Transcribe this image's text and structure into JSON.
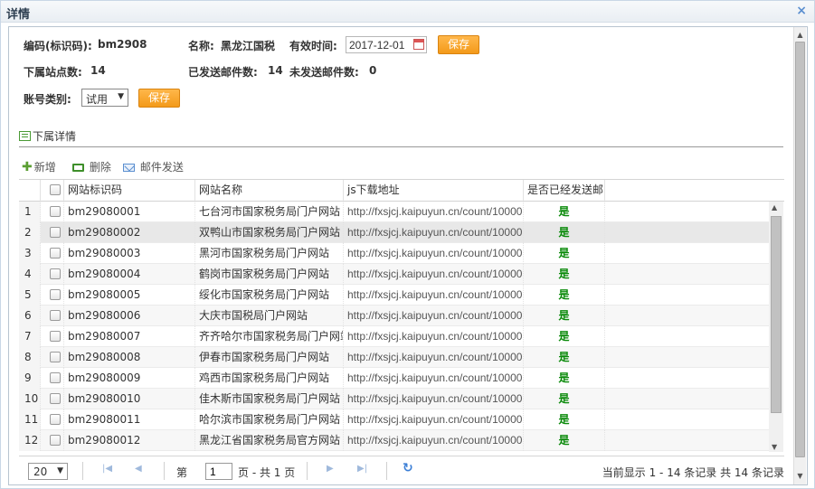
{
  "dialog": {
    "title": "详情",
    "close_glyph": "×"
  },
  "form": {
    "code_label": "编码(标识码):",
    "code_value": "bm2908",
    "name_label": "名称:",
    "name_value": "黑龙江国税",
    "valid_label": "有效时间:",
    "valid_value": "2017-12-01",
    "save_label": "保存",
    "sub_count_label": "下属站点数:",
    "sub_count_value": "14",
    "sent_label": "已发送邮件数:",
    "sent_value": "14",
    "unsent_label": "未发送邮件数:",
    "unsent_value": "0",
    "account_label": "账号类别:",
    "account_value": "试用",
    "save2_label": "保存"
  },
  "section": {
    "title": "下属详情"
  },
  "toolbar": {
    "add": "新增",
    "delete": "删除",
    "mail": "邮件发送"
  },
  "grid": {
    "columns": [
      "网站标识码",
      "网站名称",
      "js下载地址",
      "是否已经发送邮"
    ],
    "rows": [
      {
        "n": "1",
        "code": "bm29080001",
        "name": "七台河市国家税务局门户网站",
        "url": "http://fxsjcj.kaipuyun.cn/count/10000",
        "sent": "是"
      },
      {
        "n": "2",
        "code": "bm29080002",
        "name": "双鸭山市国家税务局门户网站",
        "url": "http://fxsjcj.kaipuyun.cn/count/10000",
        "sent": "是"
      },
      {
        "n": "3",
        "code": "bm29080003",
        "name": "黑河市国家税务局门户网站",
        "url": "http://fxsjcj.kaipuyun.cn/count/10000",
        "sent": "是"
      },
      {
        "n": "4",
        "code": "bm29080004",
        "name": "鹤岗市国家税务局门户网站",
        "url": "http://fxsjcj.kaipuyun.cn/count/10000",
        "sent": "是"
      },
      {
        "n": "5",
        "code": "bm29080005",
        "name": "绥化市国家税务局门户网站",
        "url": "http://fxsjcj.kaipuyun.cn/count/10000",
        "sent": "是"
      },
      {
        "n": "6",
        "code": "bm29080006",
        "name": "大庆市国税局门户网站",
        "url": "http://fxsjcj.kaipuyun.cn/count/10000",
        "sent": "是"
      },
      {
        "n": "7",
        "code": "bm29080007",
        "name": "齐齐哈尔市国家税务局门户网站",
        "url": "http://fxsjcj.kaipuyun.cn/count/10000",
        "sent": "是"
      },
      {
        "n": "8",
        "code": "bm29080008",
        "name": "伊春市国家税务局门户网站",
        "url": "http://fxsjcj.kaipuyun.cn/count/10000",
        "sent": "是"
      },
      {
        "n": "9",
        "code": "bm29080009",
        "name": "鸡西市国家税务局门户网站",
        "url": "http://fxsjcj.kaipuyun.cn/count/10000",
        "sent": "是"
      },
      {
        "n": "10",
        "code": "bm29080010",
        "name": "佳木斯市国家税务局门户网站",
        "url": "http://fxsjcj.kaipuyun.cn/count/10000",
        "sent": "是"
      },
      {
        "n": "11",
        "code": "bm29080011",
        "name": "哈尔滨市国家税务局门户网站",
        "url": "http://fxsjcj.kaipuyun.cn/count/10000",
        "sent": "是"
      },
      {
        "n": "12",
        "code": "bm29080012",
        "name": "黑龙江省国家税务局官方网站",
        "url": "http://fxsjcj.kaipuyun.cn/count/10000",
        "sent": "是"
      }
    ]
  },
  "pager": {
    "page_size": "20",
    "page_prefix": "第",
    "page_value": "1",
    "page_suffix": "页 - 共 1 页",
    "info": "当前显示 1 - 14 条记录 共 14 条记录"
  }
}
